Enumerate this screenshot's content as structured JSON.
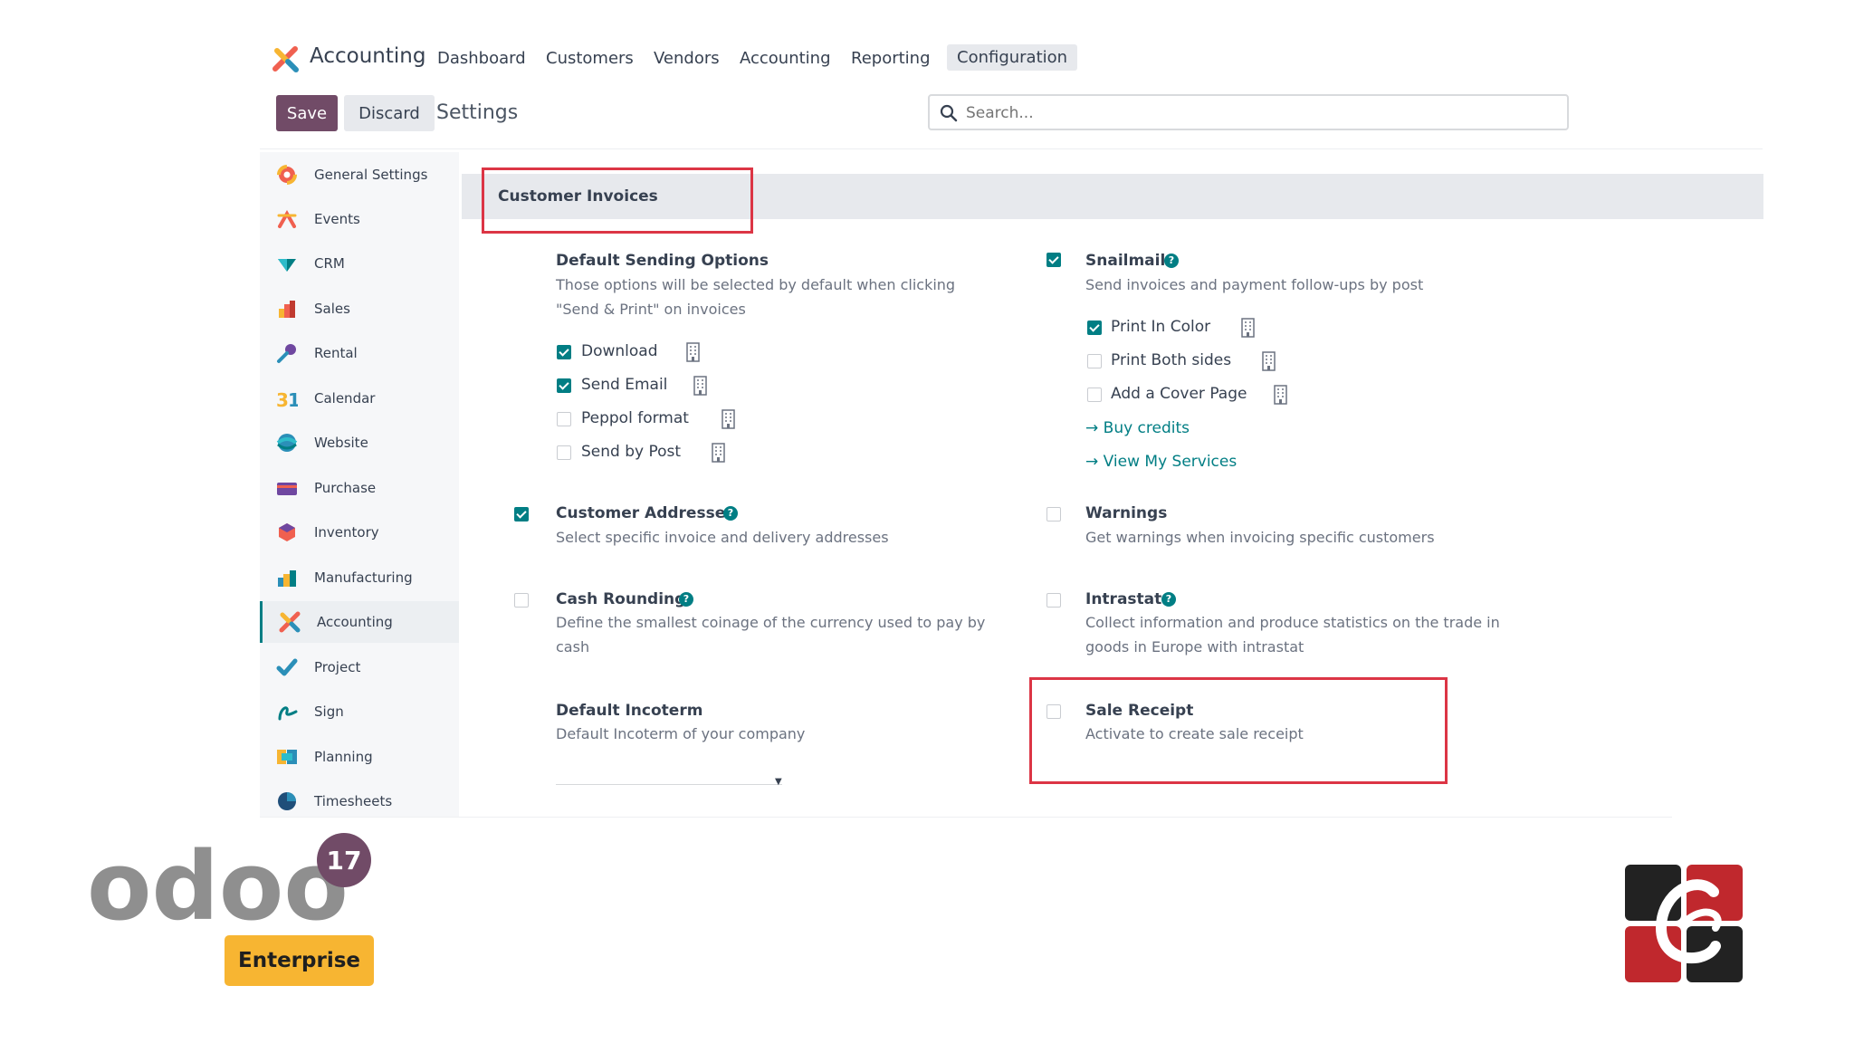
{
  "nav": {
    "app_name": "Accounting",
    "items": [
      "Dashboard",
      "Customers",
      "Vendors",
      "Accounting",
      "Reporting",
      "Configuration"
    ],
    "active": "Configuration"
  },
  "controls": {
    "save_label": "Save",
    "discard_label": "Discard",
    "page_title": "Settings",
    "search_placeholder": "Search..."
  },
  "sidebar": {
    "items": [
      {
        "label": "General Settings",
        "icon": "general-settings-icon"
      },
      {
        "label": "Events",
        "icon": "events-icon"
      },
      {
        "label": "CRM",
        "icon": "crm-icon"
      },
      {
        "label": "Sales",
        "icon": "sales-icon"
      },
      {
        "label": "Rental",
        "icon": "rental-icon"
      },
      {
        "label": "Calendar",
        "icon": "calendar-icon"
      },
      {
        "label": "Website",
        "icon": "website-icon"
      },
      {
        "label": "Purchase",
        "icon": "purchase-icon"
      },
      {
        "label": "Inventory",
        "icon": "inventory-icon"
      },
      {
        "label": "Manufacturing",
        "icon": "manufacturing-icon"
      },
      {
        "label": "Accounting",
        "icon": "accounting-icon"
      },
      {
        "label": "Project",
        "icon": "project-icon"
      },
      {
        "label": "Sign",
        "icon": "sign-icon"
      },
      {
        "label": "Planning",
        "icon": "planning-icon"
      },
      {
        "label": "Timesheets",
        "icon": "timesheets-icon"
      }
    ],
    "active": "Accounting"
  },
  "section": {
    "title": "Customer Invoices",
    "default_sending": {
      "title": "Default Sending Options",
      "desc": "Those options will be selected by default when clicking \"Send & Print\" on invoices",
      "options": [
        {
          "label": "Download",
          "checked": true
        },
        {
          "label": "Send Email",
          "checked": true
        },
        {
          "label": "Peppol format",
          "checked": false
        },
        {
          "label": "Send by Post",
          "checked": false
        }
      ]
    },
    "snailmail": {
      "title": "Snailmail",
      "checked": true,
      "desc": "Send invoices and payment follow-ups by post",
      "options": [
        {
          "label": "Print In Color",
          "checked": true
        },
        {
          "label": "Print Both sides",
          "checked": false
        },
        {
          "label": "Add a Cover Page",
          "checked": false
        }
      ],
      "links": [
        "Buy credits",
        "View My Services"
      ]
    },
    "customer_addresses": {
      "title": "Customer Addresses",
      "checked": true,
      "desc": "Select specific invoice and delivery addresses"
    },
    "warnings": {
      "title": "Warnings",
      "checked": false,
      "desc": "Get warnings when invoicing specific customers"
    },
    "cash_rounding": {
      "title": "Cash Rounding",
      "checked": false,
      "desc": "Define the smallest coinage of the currency used to pay by cash"
    },
    "intrastat": {
      "title": "Intrastat",
      "checked": false,
      "desc": "Collect information and produce statistics on the trade in goods in Europe with intrastat"
    },
    "default_incoterm": {
      "title": "Default Incoterm",
      "desc": "Default Incoterm of your company",
      "value": ""
    },
    "sale_receipt": {
      "title": "Sale Receipt",
      "checked": false,
      "desc": "Activate to create sale receipt"
    }
  },
  "brand": {
    "odoo_text": "odoo",
    "version": "17",
    "edition": "Enterprise"
  },
  "colors": {
    "primary": "#714b67",
    "teal": "#017e84",
    "highlight": "#dc3545",
    "enterprise": "#f7b532"
  }
}
